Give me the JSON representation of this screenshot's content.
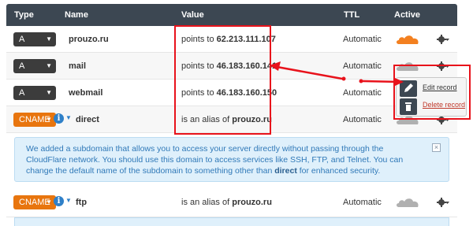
{
  "header": {
    "type": "Type",
    "name": "Name",
    "value": "Value",
    "ttl": "TTL",
    "active": "Active"
  },
  "records": [
    {
      "type": "A",
      "name": "prouzo.ru",
      "value_prefix": "points to",
      "value_target": "62.213.111.107",
      "ttl": "Automatic",
      "cloud": "orange"
    },
    {
      "type": "A",
      "name": "mail",
      "value_prefix": "points to",
      "value_target": "46.183.160.141",
      "ttl": "Automatic",
      "cloud": "grey"
    },
    {
      "type": "A",
      "name": "webmail",
      "value_prefix": "points to",
      "value_target": "46.183.160.150",
      "ttl": "Automatic",
      "cloud": "grey"
    },
    {
      "type": "CNAME",
      "name": "direct",
      "value_prefix": "is an alias of",
      "value_target": "prouzo.ru",
      "ttl": "Automatic",
      "cloud": "grey"
    },
    {
      "type": "CNAME",
      "name": "ftp",
      "value_prefix": "is an alias of",
      "value_target": "prouzo.ru",
      "ttl": "Automatic",
      "cloud": "grey"
    }
  ],
  "notice": {
    "text_before": "We added a subdomain that allows you to access your server directly without passing through the CloudFlare network. You should use this domain to access services like SSH, FTP, and Telnet. You can change the default name of the subdomain to something other than ",
    "bold": "direct",
    "text_after": " for enhanced security.",
    "close": "×"
  },
  "menu": {
    "edit": "Edit record",
    "delete": "Delete record"
  },
  "colors": {
    "header_bg": "#3c4752",
    "a_badge": "#3c3c3c",
    "cname_badge": "#e8750e",
    "cloud_active": "#f38020",
    "cloud_inactive": "#b0b0b0",
    "annotation_red": "#e8121b",
    "notice_bg": "#dff0fb"
  },
  "icons": {
    "gear": "gear-icon",
    "cloud": "cloud-icon",
    "info": "info-icon",
    "edit": "pencil-icon",
    "delete": "trash-icon",
    "close": "close-icon"
  }
}
